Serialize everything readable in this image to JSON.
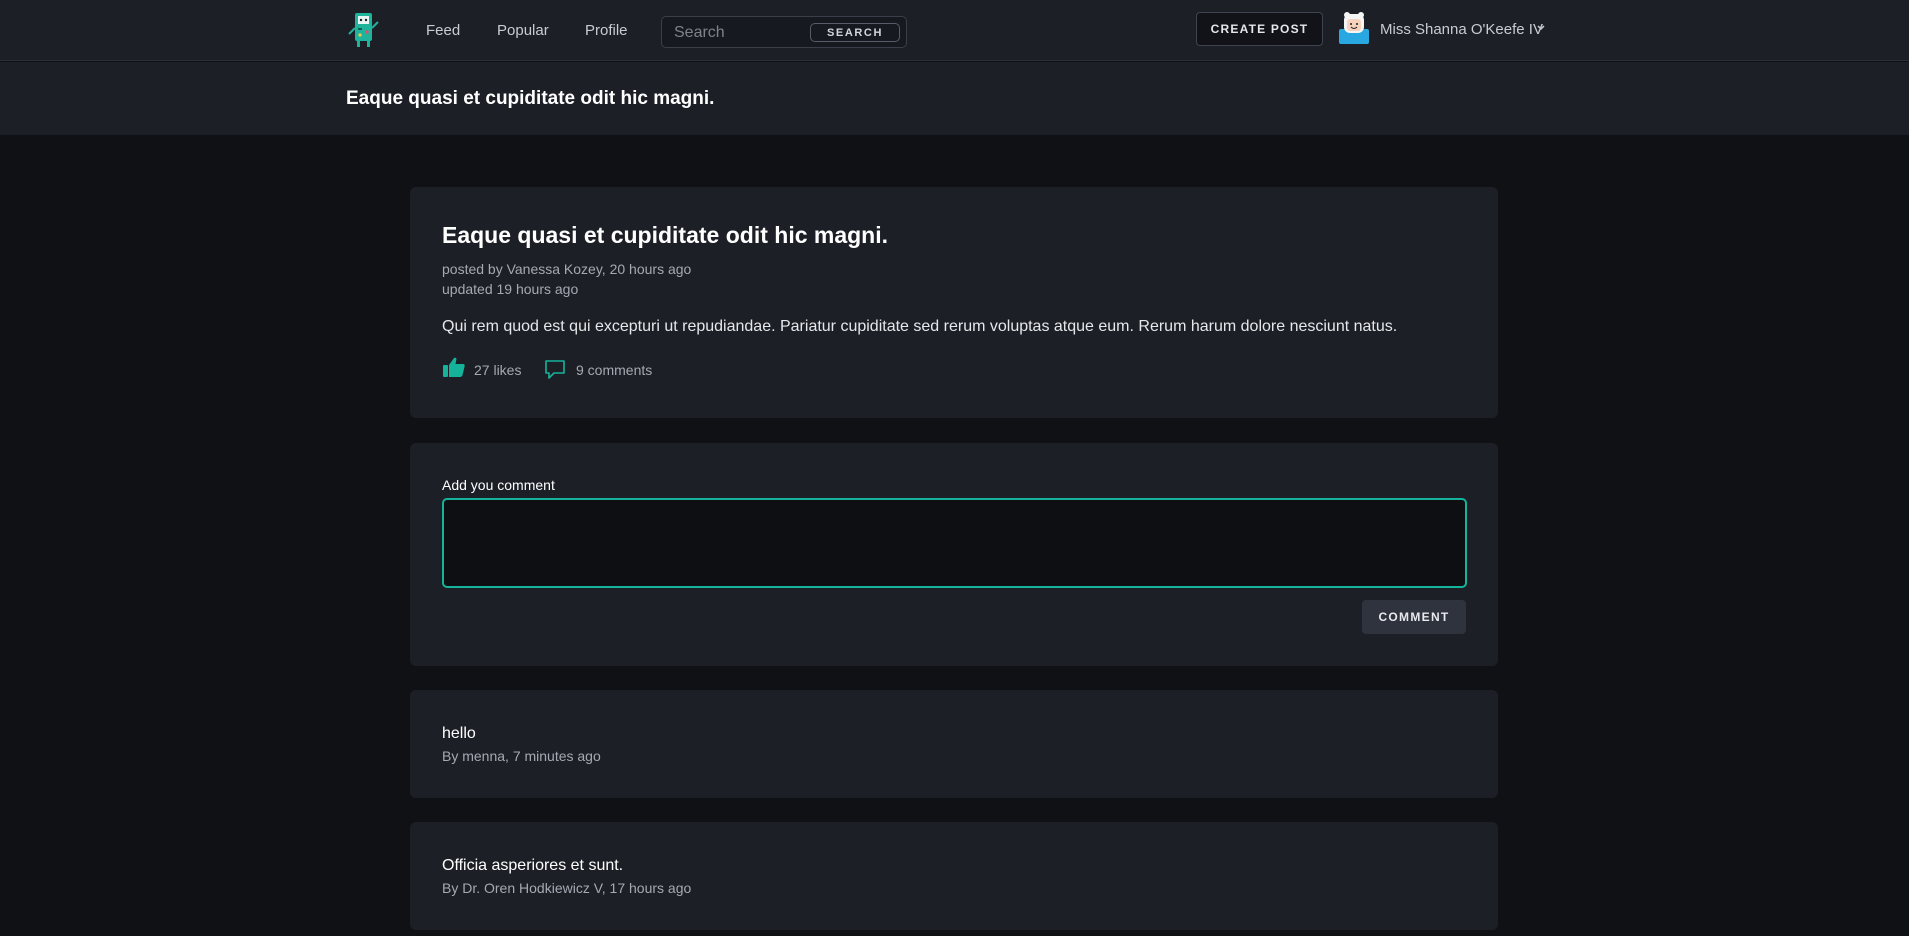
{
  "nav": {
    "links": [
      "Feed",
      "Popular",
      "Profile"
    ],
    "search_placeholder": "Search",
    "search_button": "SEARCH",
    "create_post": "CREATE POST",
    "user_name": "Miss Shanna O'Keefe IV",
    "accent": "#14b39a"
  },
  "header": {
    "title": "Eaque quasi et cupiditate odit hic magni."
  },
  "post": {
    "title": "Eaque quasi et cupiditate odit hic magni.",
    "posted": "posted by Vanessa Kozey, 20 hours ago",
    "updated": "updated 19 hours ago",
    "body": "Qui rem quod est qui excepturi ut repudiandae. Pariatur cupiditate sed rerum voluptas atque eum. Rerum harum dolore nesciunt natus.",
    "likes": "27 likes",
    "comments": "9 comments",
    "like_icon": "thumbs-up-icon",
    "comment_icon": "speech-bubble-icon"
  },
  "form": {
    "label": "Add you comment",
    "value": "",
    "button": "COMMENT"
  },
  "comments": [
    {
      "text": "hello",
      "meta": "By menna, 7 minutes ago"
    },
    {
      "text": "Officia asperiores et sunt.",
      "meta": "By Dr. Oren Hodkiewicz V, 17 hours ago"
    }
  ]
}
